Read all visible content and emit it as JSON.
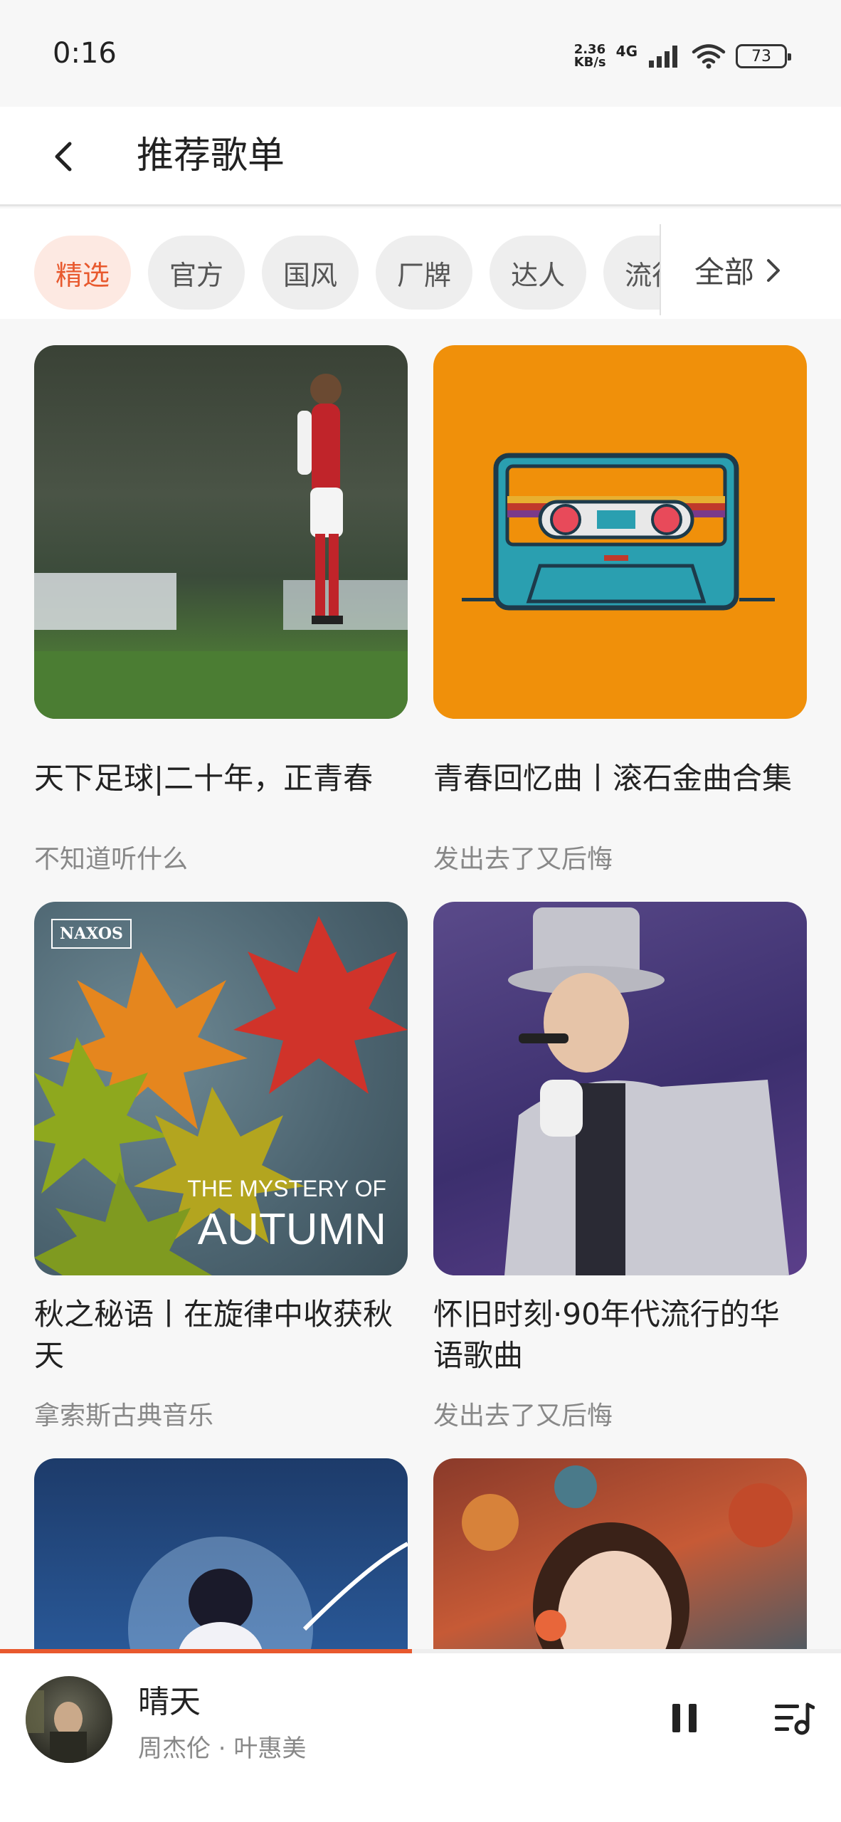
{
  "status_bar": {
    "time": "0:16",
    "net_speed_value": "2.36",
    "net_speed_unit": "KB/s",
    "network": "4G",
    "battery": "73"
  },
  "header": {
    "title": "推荐歌单"
  },
  "tabs": {
    "items": [
      "精选",
      "官方",
      "国风",
      "厂牌",
      "达人",
      "流行"
    ],
    "active_index": 0,
    "all_label": "全部"
  },
  "playlists": [
    {
      "title": "天下足球|二十年，正青春",
      "subtitle": "不知道听什么"
    },
    {
      "title": "青春回忆曲丨滚石金曲合集",
      "subtitle": "发出去了又后悔"
    },
    {
      "title": "秋之秘语丨在旋律中收获秋天",
      "subtitle": "拿索斯古典音乐",
      "cover_text_line1": "THE MYSTERY OF",
      "cover_text_line2": "AUTUMN",
      "cover_logo": "NAXOS"
    },
    {
      "title": "怀旧时刻·90年代流行的华语歌曲",
      "subtitle": "发出去了又后悔"
    }
  ],
  "player": {
    "song_title": "晴天",
    "artist": "周杰伦 · 叶惠美",
    "progress": 0.49
  },
  "colors": {
    "accent": "#e8592e",
    "accent_bg": "#fde9e2",
    "cassette_bg": "#f0900a"
  }
}
